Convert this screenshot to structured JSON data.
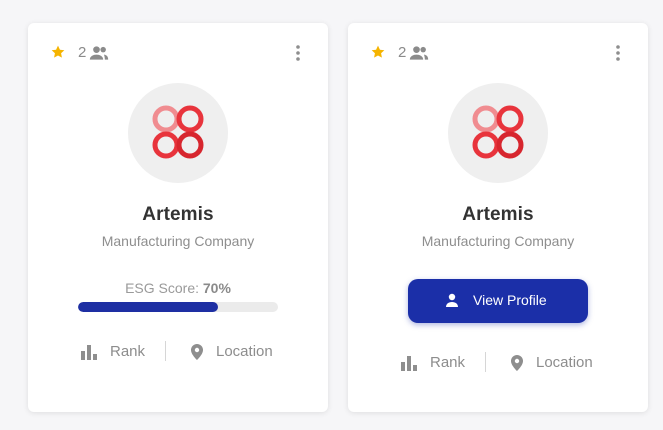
{
  "colors": {
    "accent": "#1b2fa8",
    "star": "#f5b400",
    "logo_red": "#e8343c",
    "logo_pink": "#f08c90"
  },
  "cards": [
    {
      "rating_icon": "star-icon",
      "member_count": "2",
      "members_icon": "people-icon",
      "menu_icon": "more-vert-icon",
      "logo_icon": "artemis-logo",
      "name": "Artemis",
      "subtitle": "Manufacturing Company",
      "esg": {
        "label": "ESG Score:",
        "value": "70%",
        "progress": 0.7
      },
      "footer": {
        "rank_label": "Rank",
        "rank_icon": "bar-chart-icon",
        "location_label": "Location",
        "location_icon": "location-pin-icon"
      }
    },
    {
      "rating_icon": "star-icon",
      "member_count": "2",
      "members_icon": "people-icon",
      "menu_icon": "more-vert-icon",
      "logo_icon": "artemis-logo",
      "name": "Artemis",
      "subtitle": "Manufacturing Company",
      "view_profile_label": "View Profile",
      "view_profile_icon": "person-icon",
      "footer": {
        "rank_label": "Rank",
        "rank_icon": "bar-chart-icon",
        "location_label": "Location",
        "location_icon": "location-pin-icon"
      }
    }
  ]
}
